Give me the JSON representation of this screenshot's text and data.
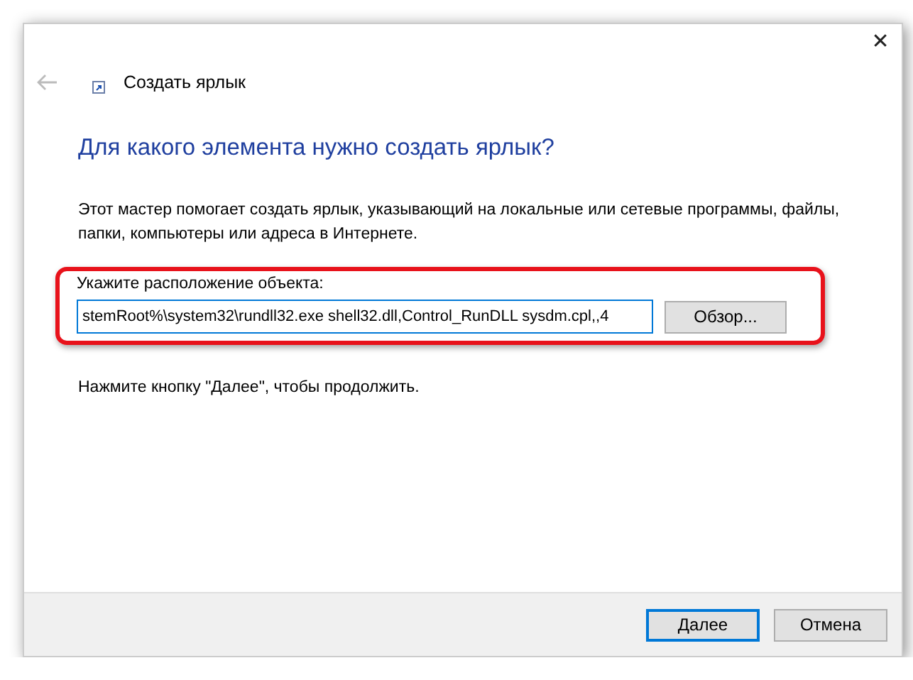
{
  "window": {
    "title": "Создать ярлык",
    "close": "✕"
  },
  "heading": "Для какого элемента нужно создать ярлык?",
  "description": "Этот мастер помогает создать ярлык, указывающий на локальные или сетевые программы, файлы, папки, компьютеры или адреса в Интернете.",
  "location": {
    "highlighted": true,
    "label": "Укажите расположение объекта:",
    "value": "stemRoot%\\system32\\rundll32.exe shell32.dll,Control_RunDLL sysdm.cpl,,4",
    "browse_button": "Обзор..."
  },
  "hint": "Нажмите кнопку \"Далее\", чтобы продолжить.",
  "buttons": [
    {
      "label": "Далее",
      "default": true
    },
    {
      "label": "Отмена",
      "default": false
    }
  ]
}
